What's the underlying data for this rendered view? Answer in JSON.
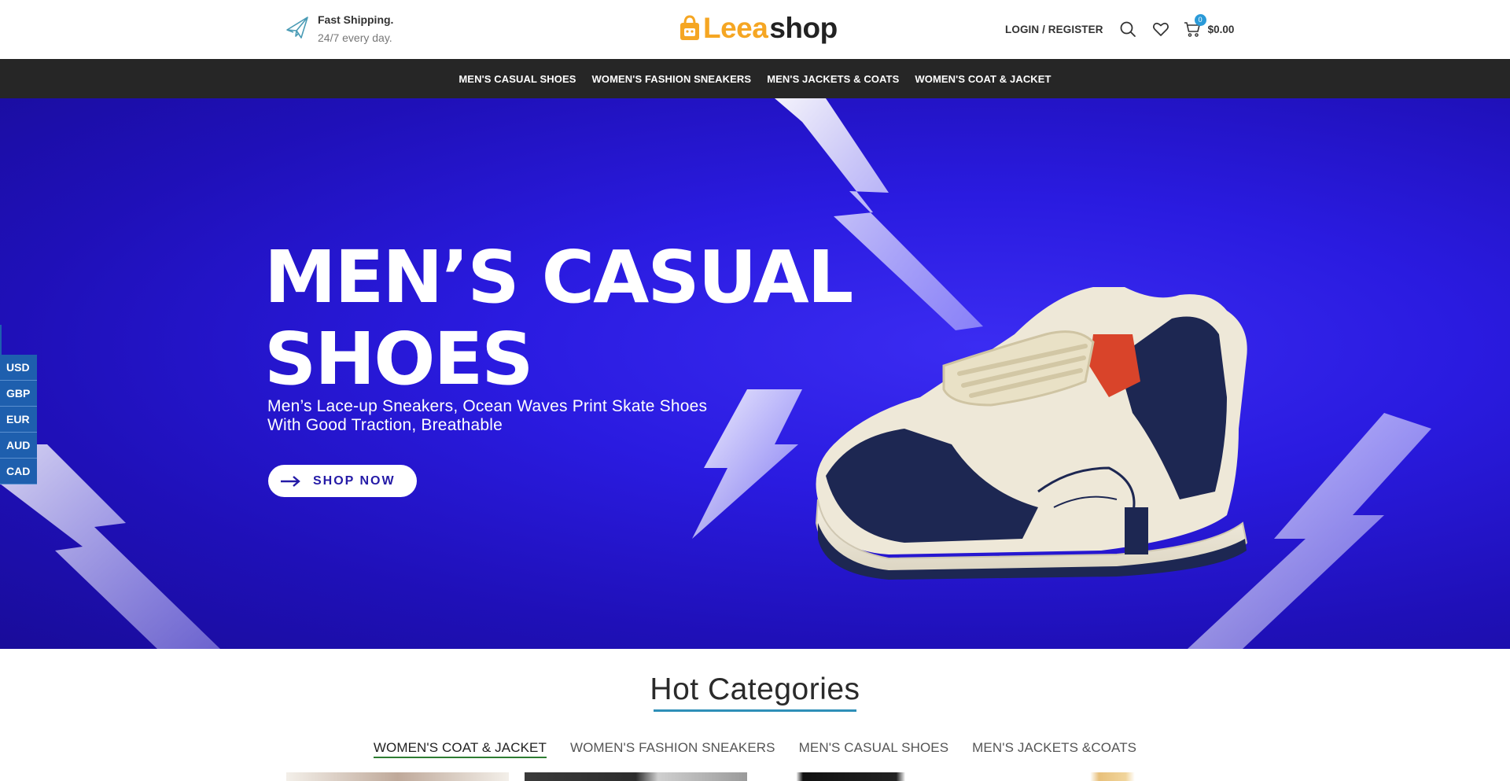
{
  "header": {
    "shipping_title": "Fast Shipping.",
    "shipping_sub": "24/7 every day.",
    "logo_part1": "Leea",
    "logo_part2": "shop",
    "login_label": "LOGIN / REGISTER",
    "cart_count": "0",
    "cart_total": "$0.00",
    "icons": [
      "plane-icon",
      "search-icon",
      "heart-icon",
      "cart-icon"
    ]
  },
  "nav": {
    "items": [
      {
        "label": "MEN'S CASUAL SHOES"
      },
      {
        "label": "WOMEN'S FASHION SNEAKERS"
      },
      {
        "label": "MEN'S JACKETS & COATS"
      },
      {
        "label": "WOMEN'S COAT & JACKET"
      }
    ]
  },
  "hero": {
    "title_line1": "MEN’S CASUAL",
    "title_line2": "SHOES",
    "subtitle_line1": "Men’s Lace-up Sneakers, Ocean Waves Print Skate Shoes",
    "subtitle_line2": "With Good Traction, Breathable",
    "button_label": "SHOP NOW"
  },
  "currency": [
    "USD",
    "GBP",
    "EUR",
    "AUD",
    "CAD"
  ],
  "hot_categories": {
    "title": "Hot Categories",
    "tabs": [
      {
        "label": "WOMEN'S COAT & JACKET",
        "active": true
      },
      {
        "label": "WOMEN'S FASHION SNEAKERS",
        "active": false
      },
      {
        "label": "MEN'S CASUAL SHOES",
        "active": false
      },
      {
        "label": "MEN'S JACKETS &COATS",
        "active": false
      }
    ]
  },
  "colors": {
    "accent": "#f5a623",
    "nav_bg": "#262626",
    "hero_bg": "#2a1be0",
    "currency_bg": "#1e5fae",
    "badge": "#2a9ad8"
  }
}
